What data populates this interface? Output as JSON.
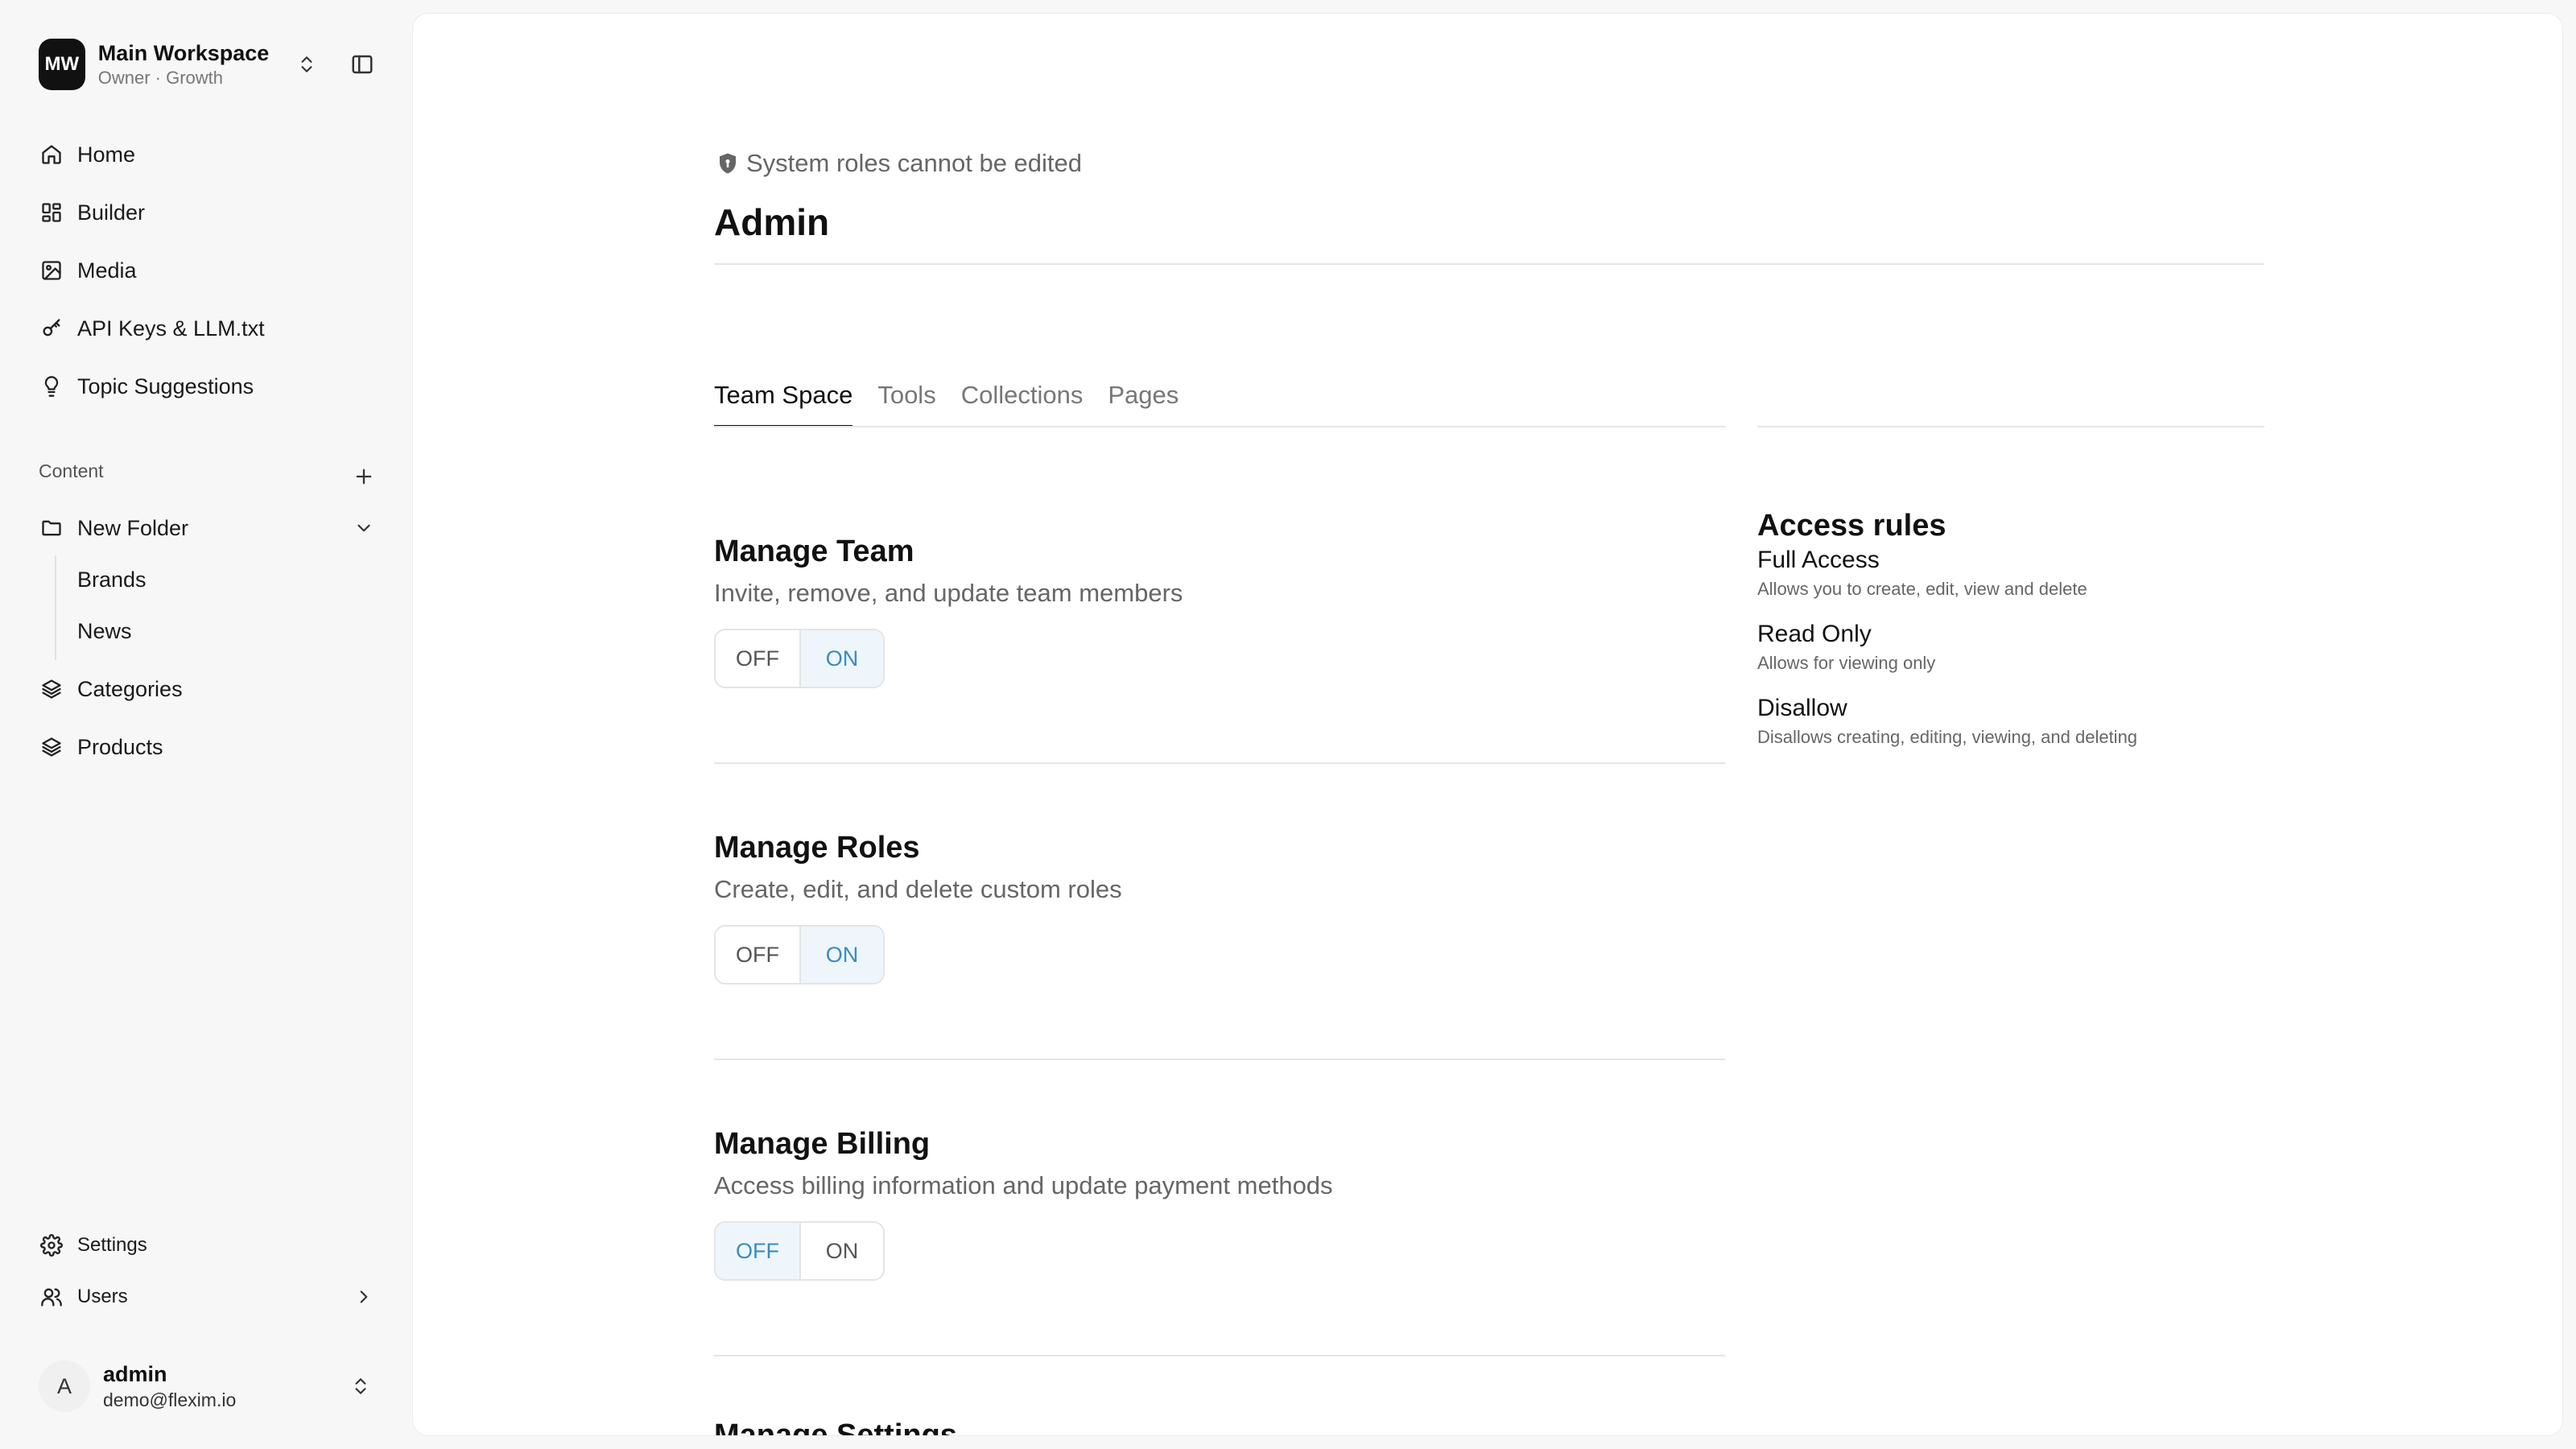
{
  "workspace": {
    "initials": "MW",
    "name": "Main Workspace",
    "subtitle": "Owner · Growth"
  },
  "nav": [
    {
      "label": "Home",
      "icon": "home-icon"
    },
    {
      "label": "Builder",
      "icon": "grid-icon"
    },
    {
      "label": "Media",
      "icon": "image-icon"
    },
    {
      "label": "API Keys & LLM.txt",
      "icon": "key-icon"
    },
    {
      "label": "Topic Suggestions",
      "icon": "lightbulb-icon"
    }
  ],
  "content": {
    "section_label": "Content",
    "folder": {
      "label": "New Folder",
      "children": [
        "Brands",
        "News"
      ]
    },
    "collections": [
      {
        "label": "Categories",
        "icon": "layers-icon"
      },
      {
        "label": "Products",
        "icon": "layers-icon"
      }
    ]
  },
  "footer_nav": [
    {
      "label": "Settings",
      "icon": "gear-icon"
    },
    {
      "label": "Users",
      "icon": "users-icon"
    }
  ],
  "user": {
    "initial": "A",
    "name": "admin",
    "email": "demo@flexim.io"
  },
  "notice": "System roles cannot be edited",
  "role_title": "Admin",
  "tabs": [
    "Team Space",
    "Tools",
    "Collections",
    "Pages"
  ],
  "active_tab": "Team Space",
  "toggle_labels": {
    "off": "OFF",
    "on": "ON"
  },
  "permissions": [
    {
      "title": "Manage Team",
      "description": "Invite, remove, and update team members",
      "value": "ON"
    },
    {
      "title": "Manage Roles",
      "description": "Create, edit, and delete custom roles",
      "value": "ON"
    },
    {
      "title": "Manage Billing",
      "description": "Access billing information and update payment methods",
      "value": "OFF"
    },
    {
      "title": "Manage Settings",
      "description": "",
      "value": ""
    }
  ],
  "access_rules": {
    "title": "Access rules",
    "items": [
      {
        "name": "Full Access",
        "description": "Allows you to create, edit, view and delete"
      },
      {
        "name": "Read Only",
        "description": "Allows for viewing only"
      },
      {
        "name": "Disallow",
        "description": "Disallows creating, editing, viewing, and deleting"
      }
    ]
  },
  "colors": {
    "accent": "#3a8bc0",
    "selected_bg": "#eef6fb",
    "logo_bg": "#111111"
  }
}
